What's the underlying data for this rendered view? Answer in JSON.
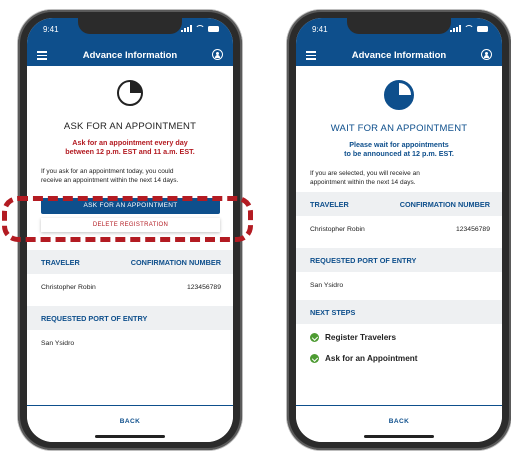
{
  "colors": {
    "brand_blue": "#0e4f8c",
    "alert_red": "#b31b22",
    "success_green": "#4d9b32"
  },
  "left": {
    "status": {
      "time": "9:41"
    },
    "nav": {
      "title": "Advance Information",
      "menu_icon": "hamburger-menu-icon",
      "profile_icon": "user-circle-icon"
    },
    "icon": "progress-clock-icon",
    "heading": "ASK FOR AN APPOINTMENT",
    "sub_line1": "Ask for an appointment every day",
    "sub_line2": "between 12 p.m. EST and 11 a.m. EST.",
    "para_line1": "If you ask for an appointment today, you could",
    "para_line2": "receive an appointment within the next 14 days.",
    "primary_button": "ASK FOR AN APPOINTMENT",
    "secondary_button": "DELETE REGISTRATION",
    "col_traveler": "TRAVELER",
    "col_confirmation": "CONFIRMATION NUMBER",
    "traveler_name": "Christopher Robin",
    "confirmation_number": "123456789",
    "port_label": "REQUESTED PORT OF ENTRY",
    "port_value": "San Ysidro",
    "back": "BACK"
  },
  "right": {
    "status": {
      "time": "9:41"
    },
    "nav": {
      "title": "Advance Information",
      "menu_icon": "hamburger-menu-icon",
      "profile_icon": "user-circle-icon"
    },
    "icon": "progress-clock-icon",
    "heading": "WAIT FOR AN APPOINTMENT",
    "sub_line1": "Please wait for appointments",
    "sub_line2": "to be announced at 12 p.m. EST.",
    "para_line1": "If you are selected, you will receive an",
    "para_line2": "appointment within the next 14 days.",
    "col_traveler": "TRAVELER",
    "col_confirmation": "CONFIRMATION NUMBER",
    "traveler_name": "Christopher Robin",
    "confirmation_number": "123456789",
    "port_label": "REQUESTED PORT OF ENTRY",
    "port_value": "San Ysidro",
    "next_steps_label": "NEXT STEPS",
    "steps": [
      "Register Travelers",
      "Ask for an Appointment"
    ],
    "back": "BACK"
  }
}
